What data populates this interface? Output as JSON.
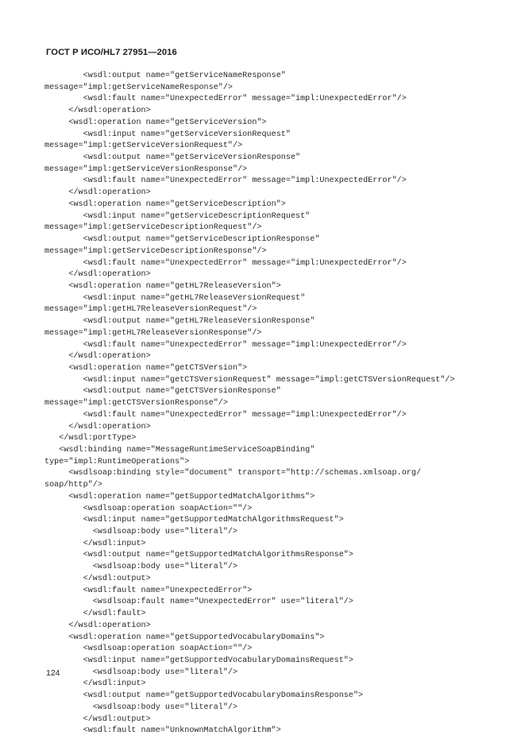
{
  "document": {
    "header_title": "ГОСТ Р ИСО/HL7 27951—2016",
    "page_number": "124",
    "language": "ru",
    "content_type": "wsdl-xml-listing"
  },
  "colors": {
    "page_background": "#ffffff",
    "header_text": "#1a1a1a",
    "code_text": "#262626",
    "page_number_text": "#1f1f1f"
  },
  "code_listing": {
    "language": "xml",
    "lines": [
      "        <wsdl:output name=\"getServiceNameResponse\"",
      "message=\"impl:getServiceNameResponse\"/>",
      "        <wsdl:fault name=\"UnexpectedError\" message=\"impl:UnexpectedError\"/>",
      "     </wsdl:operation>",
      "     <wsdl:operation name=\"getServiceVersion\">",
      "        <wsdl:input name=\"getServiceVersionRequest\"",
      "message=\"impl:getServiceVersionRequest\"/>",
      "        <wsdl:output name=\"getServiceVersionResponse\"",
      "message=\"impl:getServiceVersionResponse\"/>",
      "        <wsdl:fault name=\"UnexpectedError\" message=\"impl:UnexpectedError\"/>",
      "     </wsdl:operation>",
      "     <wsdl:operation name=\"getServiceDescription\">",
      "        <wsdl:input name=\"getServiceDescriptionRequest\"",
      "message=\"impl:getServiceDescriptionRequest\"/>",
      "        <wsdl:output name=\"getServiceDescriptionResponse\"",
      "message=\"impl:getServiceDescriptionResponse\"/>",
      "        <wsdl:fault name=\"UnexpectedError\" message=\"impl:UnexpectedError\"/>",
      "     </wsdl:operation>",
      "     <wsdl:operation name=\"getHL7ReleaseVersion\">",
      "        <wsdl:input name=\"getHL7ReleaseVersionRequest\"",
      "message=\"impl:getHL7ReleaseVersionRequest\"/>",
      "        <wsdl:output name=\"getHL7ReleaseVersionResponse\"",
      "message=\"impl:getHL7ReleaseVersionResponse\"/>",
      "        <wsdl:fault name=\"UnexpectedError\" message=\"impl:UnexpectedError\"/>",
      "     </wsdl:operation>",
      "     <wsdl:operation name=\"getCTSVersion\">",
      "        <wsdl:input name=\"getCTSVersionRequest\" message=\"impl:getCTSVersionRequest\"/>",
      "        <wsdl:output name=\"getCTSVersionResponse\"",
      "message=\"impl:getCTSVersionResponse\"/>",
      "        <wsdl:fault name=\"UnexpectedError\" message=\"impl:UnexpectedError\"/>",
      "     </wsdl:operation>",
      "   </wsdl:portType>",
      "   <wsdl:binding name=\"MessageRuntimeServiceSoapBinding\"",
      "type=\"impl:RuntimeOperations\">",
      "     <wsdlsoap:binding style=\"document\" transport=\"http://schemas.xmlsoap.org/",
      "soap/http\"/>",
      "     <wsdl:operation name=\"getSupportedMatchAlgorithms\">",
      "        <wsdlsoap:operation soapAction=\"\"/>",
      "        <wsdl:input name=\"getSupportedMatchAlgorithmsRequest\">",
      "          <wsdlsoap:body use=\"literal\"/>",
      "        </wsdl:input>",
      "        <wsdl:output name=\"getSupportedMatchAlgorithmsResponse\">",
      "          <wsdlsoap:body use=\"literal\"/>",
      "        </wsdl:output>",
      "        <wsdl:fault name=\"UnexpectedError\">",
      "          <wsdlsoap:fault name=\"UnexpectedError\" use=\"literal\"/>",
      "        </wsdl:fault>",
      "     </wsdl:operation>",
      "     <wsdl:operation name=\"getSupportedVocabularyDomains\">",
      "        <wsdlsoap:operation soapAction=\"\"/>",
      "        <wsdl:input name=\"getSupportedVocabularyDomainsRequest\">",
      "          <wsdlsoap:body use=\"literal\"/>",
      "        </wsdl:input>",
      "        <wsdl:output name=\"getSupportedVocabularyDomainsResponse\">",
      "          <wsdlsoap:body use=\"literal\"/>",
      "        </wsdl:output>",
      "        <wsdl:fault name=\"UnknownMatchAlgorithm\">"
    ]
  }
}
